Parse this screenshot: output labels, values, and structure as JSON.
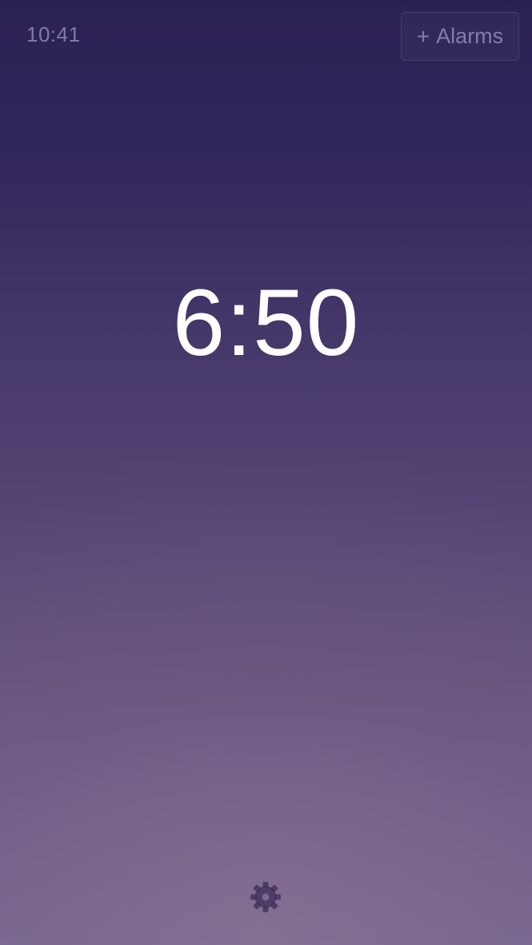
{
  "status_bar": {
    "time": "10:41"
  },
  "header": {
    "alarms_button": {
      "plus": "+",
      "label": "Alarms"
    }
  },
  "main": {
    "clock_time": "6:50"
  },
  "footer": {
    "settings_icon": "gear-icon"
  },
  "colors": {
    "background_top": "#2a2153",
    "background_bottom": "#786890",
    "clock_text": "#ffffff",
    "muted_text": "#c8c3e1"
  }
}
